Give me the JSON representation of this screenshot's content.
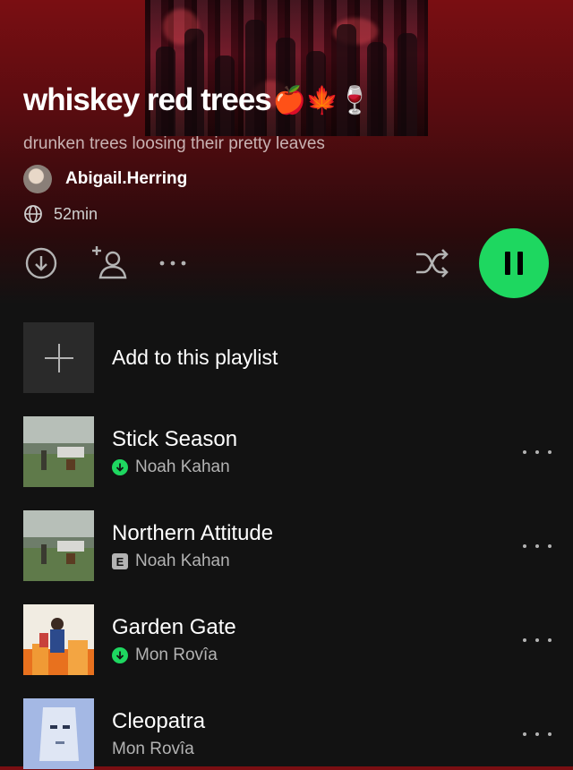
{
  "playlist": {
    "title": "whiskey red trees",
    "title_emojis": "🍎🍁🍷",
    "description": "drunken trees loosing their pretty leaves",
    "owner": "Abigail.Herring",
    "duration": "52min"
  },
  "actions": {
    "download_icon": "download-circle-icon",
    "add_user_icon": "add-user-icon",
    "more_icon": "more-horizontal-icon",
    "shuffle_icon": "shuffle-icon",
    "play_state_icon": "pause-icon"
  },
  "add_to_playlist": {
    "label": "Add to this playlist"
  },
  "tracks": [
    {
      "title": "Stick Season",
      "artist": "Noah Kahan",
      "badge": "downloaded"
    },
    {
      "title": "Northern Attitude",
      "artist": "Noah Kahan",
      "badge": "E"
    },
    {
      "title": "Garden Gate",
      "artist": "Mon Rovîa",
      "badge": "downloaded"
    },
    {
      "title": "Cleopatra",
      "artist": "Mon Rovîa",
      "badge": ""
    }
  ],
  "colors": {
    "accent": "#1ed760",
    "header": "#7a0e12",
    "background": "#121212"
  }
}
